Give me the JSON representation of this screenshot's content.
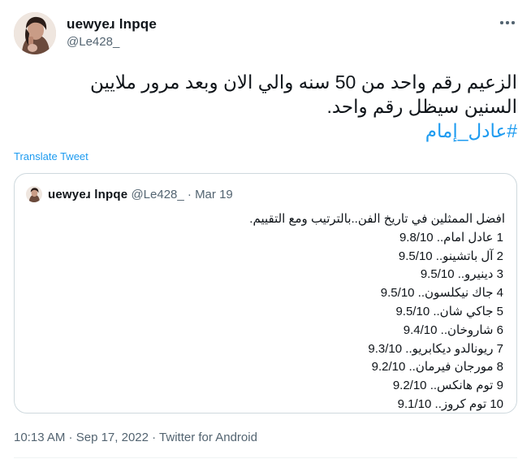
{
  "author": {
    "display_name": "uewyeɹ lnpqe",
    "handle": "@Le428_"
  },
  "tweet": {
    "line1": "الزعيم رقم واحد من 50 سنه والي الان وبعد مرور ملايين",
    "line2": "السنين سيظل رقم واحد.",
    "hashtag": "#عادل_إمام"
  },
  "translate_label": "Translate Tweet",
  "quoted": {
    "display_name": "uewyeɹ lnpqe",
    "handle": "@Le428_",
    "separator": "·",
    "date": "Mar 19",
    "intro": "افضل الممثلين في تاريخ الفن..بالترتيب ومع التقييم.",
    "rankings": [
      "1 عادل امام.. 9.8/10",
      "2 آل باتشينو.. 9.5/10",
      "3 دينيرو.. 9.5/10",
      "4 جاك نيكلسون.. 9.5/10",
      "5 جاكي شان.. 9.5/10",
      "6 شاروخان.. 9.4/10",
      "7 ريونالدو ديكابريو.. 9.3/10",
      "8 مورجان فيرمان.. 9.2/10",
      "9 توم هانكس.. 9.2/10",
      "10 توم كروز.. 9.1/10"
    ]
  },
  "footer": {
    "time": "10:13 AM",
    "sep1": " · ",
    "date": "Sep 17, 2022",
    "sep2": " · ",
    "source": "Twitter for Android"
  },
  "icons": {
    "more": "more-horizontal-icon",
    "avatar": "profile-photo"
  },
  "colors": {
    "link": "#1d9bf0",
    "secondary_text": "#536471",
    "border": "#cfd9de"
  }
}
